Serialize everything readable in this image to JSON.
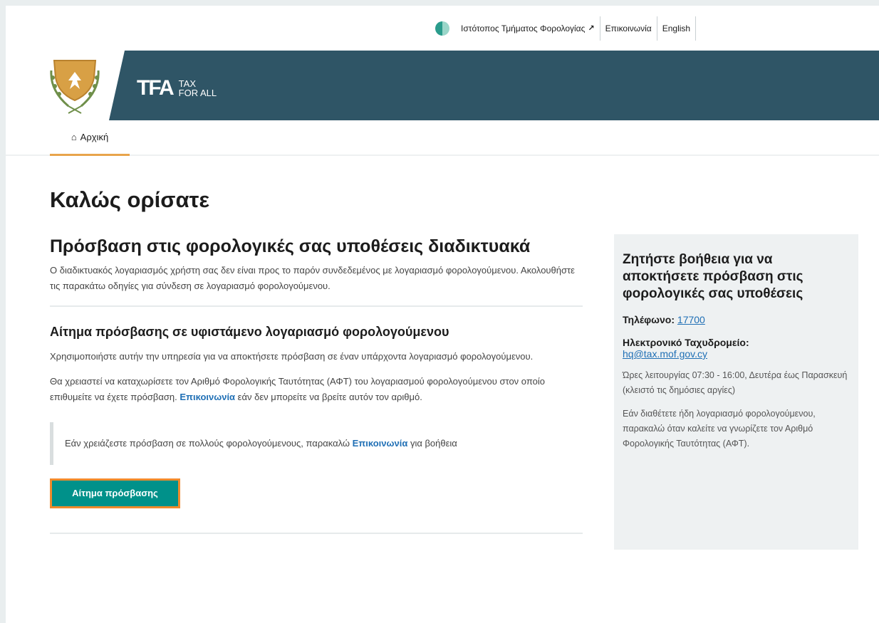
{
  "topbar": {
    "tax_dept_link": "Ιστότοπος Τμήματος Φορολογίας",
    "external_icon": "↗",
    "contact_link": "Επικοινωνία",
    "language_link": "English"
  },
  "header": {
    "logo_mark": "TFA",
    "logo_text_line1": "TAX",
    "logo_text_line2": "FOR ALL"
  },
  "nav": {
    "home_icon": "⌂",
    "home_label": "Αρχική"
  },
  "main": {
    "welcome": "Καλώς ορίσατε",
    "heading": "Πρόσβαση στις φορολογικές σας υποθέσεις διαδικτυακά",
    "intro": "Ο διαδικτυακός λογαριασμός χρήστη σας δεν είναι προς το παρόν συνδεδεμένος με λογαριασμό φορολογούμενου. Ακολουθήστε τις παρακάτω οδηγίες για σύνδεση σε λογαριασμό φορολογούμενου.",
    "subheading": "Αίτημα πρόσβασης σε υφιστάμενο λογαριασμό φορολογούμενου",
    "para1": "Χρησιμοποιήστε αυτήν την υπηρεσία για να αποκτήσετε πρόσβαση σε έναν υπάρχοντα λογαριασμό φορολογούμενου.",
    "para2_before": "Θα χρειαστεί να καταχωρίσετε τον Αριθμό Φορολογικής Ταυτότητας (ΑΦΤ) του λογαριασμού φορολογούμενου στον οποίο επιθυμείτε να έχετε πρόσβαση. ",
    "para2_link": "Επικοινωνία",
    "para2_after": " εάν δεν μπορείτε να βρείτε αυτόν τον αριθμό.",
    "inset_before": "Εάν χρειάζεστε πρόσβαση σε πολλούς φορολογούμενους, παρακαλώ ",
    "inset_link": "Επικοινωνία",
    "inset_after": " για βοήθεια",
    "request_button": "Αίτημα πρόσβασης"
  },
  "sidebar": {
    "heading": "Ζητήστε βοήθεια για να αποκτήσετε πρόσβαση στις φορολογικές σας υποθέσεις",
    "phone_label": "Τηλέφωνο: ",
    "phone_value": "17700",
    "email_label": "Ηλεκτρονικό Ταχυδρομείο:",
    "email_value": "hq@tax.mof.gov.cy",
    "hours": "Ώρες λειτουργίας 07:30 - 16:00, Δευτέρα έως Παρασκευή (κλειστό τις δημόσιες αργίες)",
    "note": "Εάν διαθέτετε ήδη λογαριασμό φορολογούμενου, παρακαλώ όταν καλείτε να γνωρίζετε τον Αριθμό Φορολογικής Ταυτότητας (ΑΦΤ)."
  },
  "colors": {
    "banner": "#2f5566",
    "accent_teal": "#00918a",
    "focus_orange": "#f08a2c",
    "nav_underline": "#e8a44b",
    "link_blue": "#1f6fb5"
  }
}
